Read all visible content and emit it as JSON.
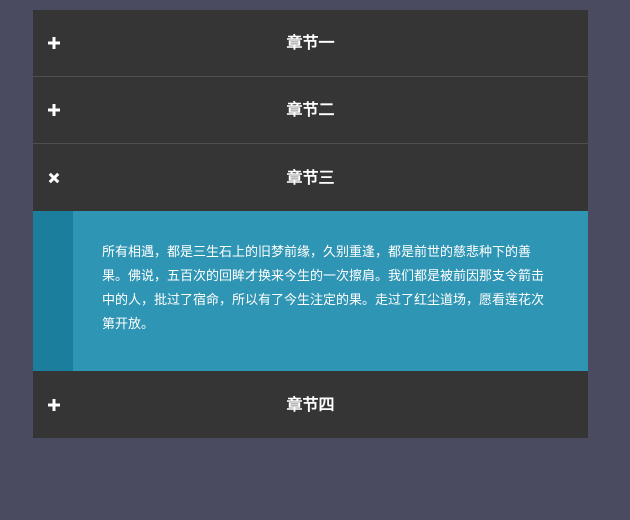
{
  "colors": {
    "page_background": "#4a4a61",
    "header_background": "#353535",
    "content_background": "#2f95b4",
    "content_accent_bar": "#1c7e9d",
    "text": "#ffffff"
  },
  "sections": [
    {
      "title": "章节一",
      "icon": "plus-icon",
      "expanded": false
    },
    {
      "title": "章节二",
      "icon": "plus-icon",
      "expanded": false
    },
    {
      "title": "章节三",
      "icon": "close-icon",
      "expanded": true,
      "content": "所有相遇，都是三生石上的旧梦前缘，久别重逢，都是前世的慈悲种下的善果。佛说，五百次的回眸才换来今生的一次擦肩。我们都是被前因那支令箭击中的人，批过了宿命，所以有了今生注定的果。走过了红尘道场，愿看莲花次第开放。"
    },
    {
      "title": "章节四",
      "icon": "plus-icon",
      "expanded": false
    }
  ]
}
